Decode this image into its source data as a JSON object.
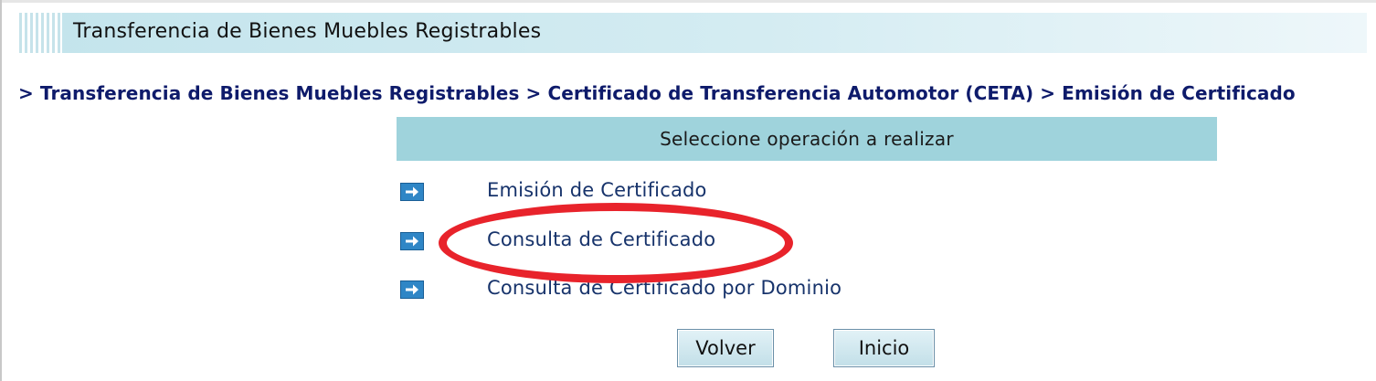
{
  "header": {
    "title": "Transferencia de Bienes Muebles Registrables"
  },
  "breadcrumb": {
    "text": "> Transferencia de Bienes Muebles Registrables > Certificado de Transferencia Automotor (CETA) > Emisión de Certificado"
  },
  "panel": {
    "title": "Seleccione operación a realizar",
    "items": [
      {
        "label": "Emisión de Certificado",
        "icon": "arrow-right-icon"
      },
      {
        "label": "Consulta de Certificado",
        "icon": "arrow-right-icon",
        "highlighted": true
      },
      {
        "label": "Consulta de Certificado por Dominio",
        "icon": "arrow-right-icon"
      }
    ]
  },
  "buttons": {
    "back_label": "Volver",
    "home_label": "Inicio"
  },
  "colors": {
    "header_band": "#c3e4ec",
    "panel_header": "#9fd3dc",
    "link_text": "#17336b",
    "breadcrumb_text": "#0e1b6b",
    "arrow_icon": "#2f86c6",
    "highlight_ring": "#e8232b"
  }
}
